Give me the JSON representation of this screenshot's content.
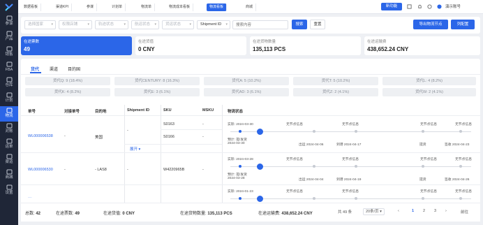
{
  "sidebar": {
    "items": [
      {
        "label": "参谋",
        "icon": "people-icon"
      },
      {
        "label": "产品",
        "icon": "box-icon"
      },
      {
        "label": "销售",
        "icon": "chart-icon"
      },
      {
        "label": "FBA",
        "icon": "truck-icon"
      },
      {
        "label": "仓库",
        "icon": "warehouse-icon"
      },
      {
        "label": "计划",
        "icon": "calendar-icon"
      },
      {
        "label": "物流",
        "icon": "shipping-icon"
      },
      {
        "label": "对账",
        "icon": "ledger-icon"
      },
      {
        "label": "运单",
        "icon": "waybill-icon"
      },
      {
        "label": "渠道",
        "icon": "channel-icon"
      },
      {
        "label": "商城",
        "icon": "shop-icon"
      },
      {
        "label": "设置",
        "icon": "gear-icon"
      }
    ]
  },
  "topbar": {
    "tabs": [
      "数据看板",
      "渠道KPI",
      "参谋",
      "计划单",
      "物流单",
      "物流成本看板",
      "物流看板",
      "商城"
    ],
    "active_tab": "物流看板",
    "new_button": "新功能",
    "account": "演示账号"
  },
  "filters": {
    "selects": [
      "选择国家",
      "权限店铺",
      "轨迹状态",
      "航运状态",
      "货运状态"
    ],
    "shipment_select": "Shipment ID",
    "search_placeholder": "搜索内容",
    "search_button": "搜索",
    "reset_button": "重置",
    "export_button": "导出物流节点",
    "config_button": "列配置"
  },
  "stats": [
    {
      "title": "在途票数",
      "value": "49"
    },
    {
      "title": "在途货值",
      "value": "0 CNY"
    },
    {
      "title": "在途货物数量",
      "value": "135,113 PCS"
    },
    {
      "title": "在途运输费",
      "value": "438,652.24 CNY"
    }
  ],
  "subtabs": [
    "货代",
    "渠道",
    "目的国"
  ],
  "chips": [
    "货代Q: 9 (18.4%)",
    "货代CENTURY: 8 (16.3%)",
    "货代A: 5 (10.2%)",
    "货代T: 5 (10.2%)",
    "货代L: 4 (8.2%)",
    "货代K: 4 (8.2%)",
    "货代E: 3 (6.1%)",
    "货代AD: 3 (6.1%)",
    "货代Z: 2 (4.1%)",
    "货代W: 2 (4.1%)"
  ],
  "table": {
    "headers": [
      "单号",
      "对接单号",
      "目的地",
      "Shipment ID",
      "SKU",
      "MSKU",
      "物流状态"
    ],
    "rows": [
      {
        "order": "WL000006538",
        "ref": "-",
        "dest": "美国",
        "shipment": "-",
        "skus": [
          "S0163",
          "S0166"
        ],
        "msku": [
          "-",
          "-"
        ],
        "expand": "展开"
      },
      {
        "order": "WL000006530",
        "ref": "-",
        "dest": "- LAS8",
        "shipment": "-",
        "skus": [
          "W4220965B"
        ],
        "msku": [
          "-"
        ]
      }
    ]
  },
  "timelines": [
    {
      "actual": "实际: 2024-03-30",
      "eta_label": "预计: 提/发货",
      "eta_date": "2024-03-30",
      "nodes": [
        "无节点信息",
        "无节点信息",
        "无节点信息",
        "无节点信息"
      ],
      "bottom": [
        "出运 2024-04-06",
        "到港 2024-04-17",
        "提货",
        "签收 2024-04-23"
      ]
    },
    {
      "actual": "实际: 2024-03-28",
      "eta_label": "预计: 提/发货",
      "eta_date": "2024-03-28",
      "nodes": [
        "无节点信息",
        "无节点信息",
        "无节点信息",
        "无节点信息"
      ],
      "bottom": [
        "出运 2024-04-04",
        "到港 2024-04-19",
        "提货",
        "签收 2024-04-26"
      ]
    },
    {
      "actual": "实际: 2024-01-23",
      "nodes": [
        "无节点信息",
        "无节点信息",
        "无节点信息",
        "无节点信息"
      ]
    }
  ],
  "summary": {
    "total_label": "总数:",
    "total": "42",
    "count_label": "在途票数:",
    "count": "49",
    "value_label": "在途货值:",
    "value": "0 CNY",
    "qty_label": "在途货物数量:",
    "qty": "135,113 PCS",
    "fee_label": "在途运输费:",
    "fee": "438,652.24 CNY"
  },
  "pagination": {
    "total": "共 49 条",
    "page_size": "20条/页",
    "prev": "‹",
    "pages": [
      "1",
      "2",
      "3"
    ],
    "next": "›",
    "goto": "前往"
  }
}
